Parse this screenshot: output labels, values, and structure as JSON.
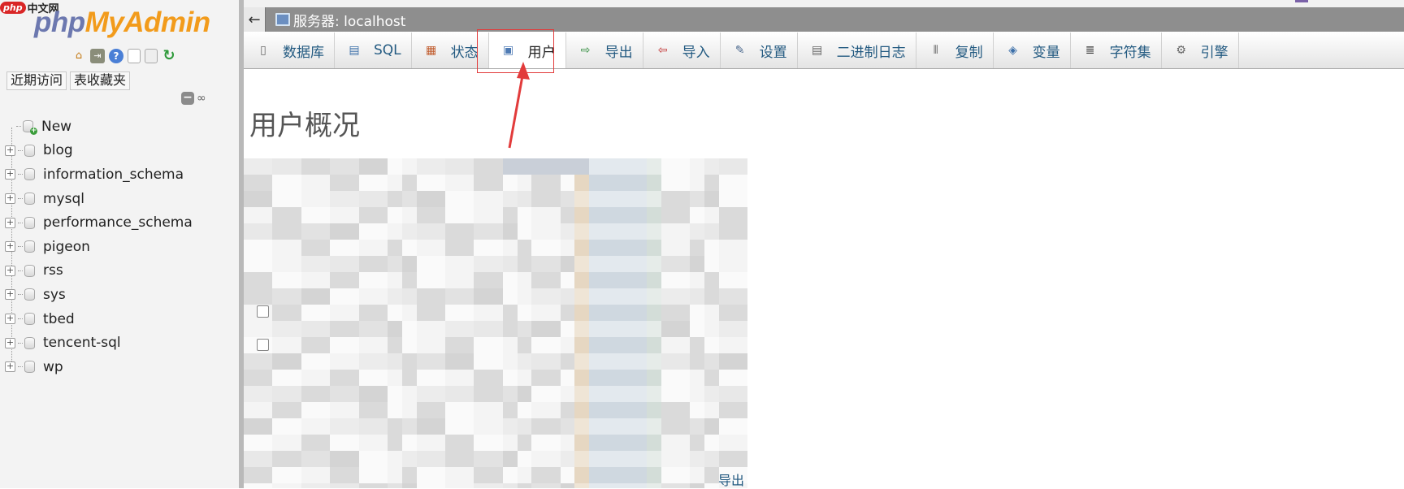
{
  "watermark": {
    "brand": "php",
    "text": "中文网"
  },
  "logo": {
    "part1": "php",
    "part2": "MyAdmin"
  },
  "quick_icons": [
    "home-icon",
    "exit-icon",
    "help-icon",
    "docs-icon",
    "docs-alt-icon",
    "reload-icon"
  ],
  "nav_buttons": {
    "recent": "近期访问",
    "favorites": "表收藏夹"
  },
  "tree": {
    "items": [
      {
        "label": "New",
        "kind": "new"
      },
      {
        "label": "blog"
      },
      {
        "label": "information_schema"
      },
      {
        "label": "mysql"
      },
      {
        "label": "performance_schema"
      },
      {
        "label": "pigeon"
      },
      {
        "label": "rss"
      },
      {
        "label": "sys"
      },
      {
        "label": "tbed"
      },
      {
        "label": "tencent-sql"
      },
      {
        "label": "wp"
      }
    ]
  },
  "breadcrumb": {
    "server": "服务器: localhost"
  },
  "tabs": [
    {
      "label": "数据库",
      "icon": "database-icon"
    },
    {
      "label": "SQL",
      "icon": "sql-icon"
    },
    {
      "label": "状态",
      "icon": "status-icon"
    },
    {
      "label": "用户",
      "icon": "users-icon",
      "active": true
    },
    {
      "label": "导出",
      "icon": "export-icon"
    },
    {
      "label": "导入",
      "icon": "import-icon"
    },
    {
      "label": "设置",
      "icon": "settings-icon"
    },
    {
      "label": "二进制日志",
      "icon": "binlog-icon"
    },
    {
      "label": "复制",
      "icon": "replication-icon"
    },
    {
      "label": "变量",
      "icon": "variables-icon"
    },
    {
      "label": "字符集",
      "icon": "charset-icon"
    },
    {
      "label": "引擎",
      "icon": "engine-icon"
    }
  ],
  "main": {
    "title": "用户概况",
    "partial_link_text": "导出"
  },
  "colors": {
    "annotation": "#e23b3b",
    "link": "#235a81",
    "topbar": "#8e8e8e"
  }
}
